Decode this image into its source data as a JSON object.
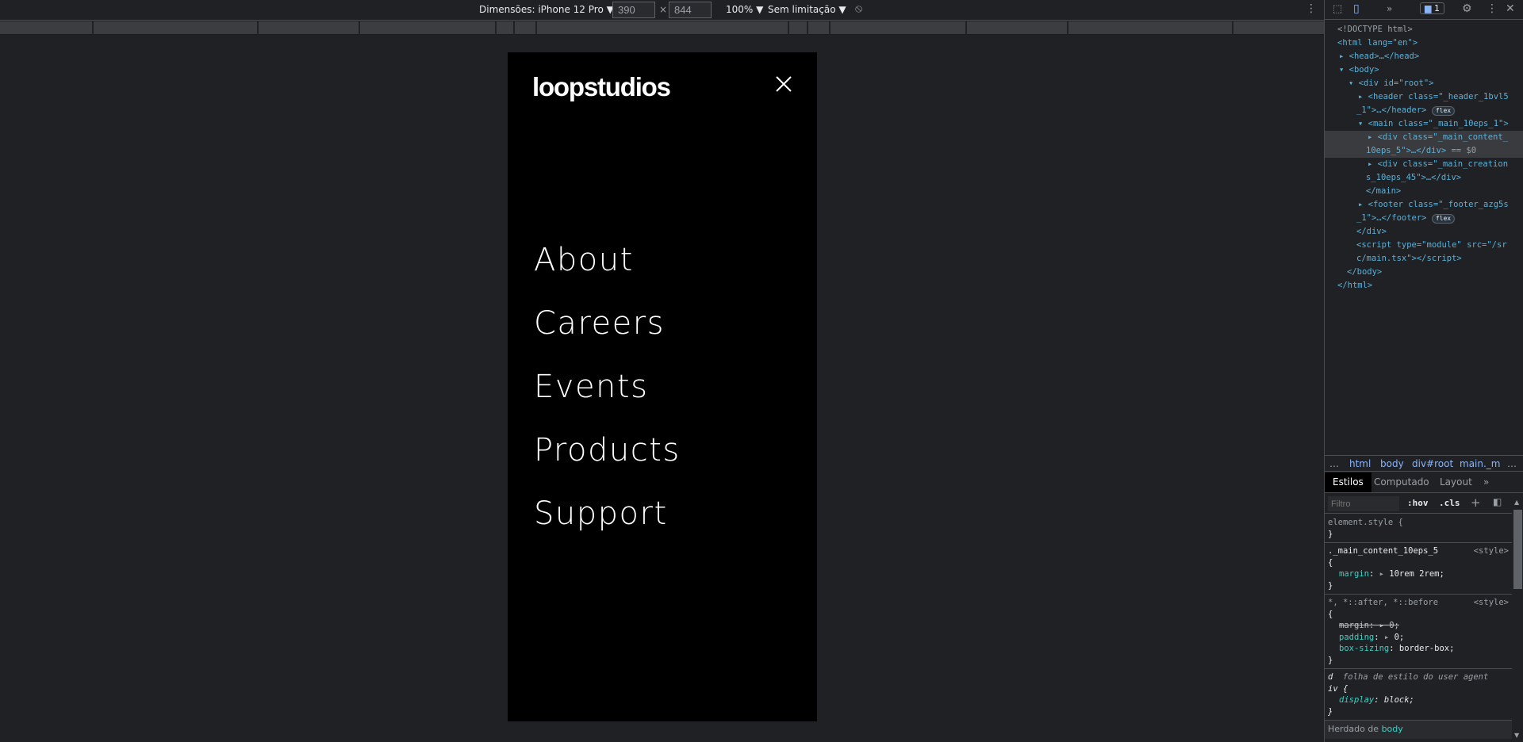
{
  "toolbar": {
    "device": "Dimensões: iPhone 12 Pro ▼",
    "width": "390",
    "times": "×",
    "height": "844",
    "zoom": "100% ▼",
    "throttle": "Sem limitação ▼"
  },
  "site": {
    "logo": "loopstudios",
    "menu": [
      "About",
      "Careers",
      "Events",
      "Products",
      "Support"
    ]
  },
  "devtools": {
    "issues_count": "1",
    "tree": {
      "l1": "<!DOCTYPE html>",
      "html_open": "<html lang=\"en\">",
      "head": "<head>…</head>",
      "body_open": "<body>",
      "root_open": "<div id=\"root\">",
      "header_a": "<header class=\"_header_1bvl5",
      "header_b": "_1\">…</header>",
      "main_open": "<main class=\"_main_10eps_1\">",
      "content_a": "<div class=\"_main_content_",
      "content_b": "10eps_5\">…</div>",
      "content_sel": "== $0",
      "creations_a": "<div class=\"_main_creation",
      "creations_b": "s_10eps_45\">…</div>",
      "main_close": "</main>",
      "footer_a": "<footer class=\"_footer_azg5s",
      "footer_b": "_1\">…</footer>",
      "root_close": "</div>",
      "script_a": "<script type=\"module\" src=\"/sr",
      "script_b": "c/main.tsx\"></script>",
      "body_close": "</body>",
      "html_close": "</html>",
      "flex_badge": "flex"
    },
    "breadcrumbs": [
      "…",
      "html",
      "body",
      "div#root",
      "main._ma",
      "…"
    ],
    "tabs": [
      "Estilos",
      "Computado",
      "Layout",
      "»"
    ],
    "filter_placeholder": "Filtro",
    "hov": ":hov",
    "cls": ".cls",
    "styles": {
      "r1_sel": "element.style {",
      "close": "}",
      "open": "{",
      "r2_sel": "._main_content_10eps_5",
      "r2_src": "<style>",
      "r2_prop": "margin",
      "r2_val": "10rem 2rem;",
      "r3_sel": "*, *::after, *::before",
      "r3_src": "<style>",
      "r3_p1": "margin",
      "r3_v1": "0;",
      "r3_p2": "padding",
      "r3_v2": "0;",
      "r3_p3": "box-sizing",
      "r3_v3": "border-box;",
      "r4_sel_a": "d",
      "r4_src": "folha de estilo do user agent",
      "r4_sel_b": "iv {",
      "r4_prop": "display",
      "r4_val": "block;",
      "inherited_label": "Herdado de",
      "inherited_el": "body"
    }
  }
}
